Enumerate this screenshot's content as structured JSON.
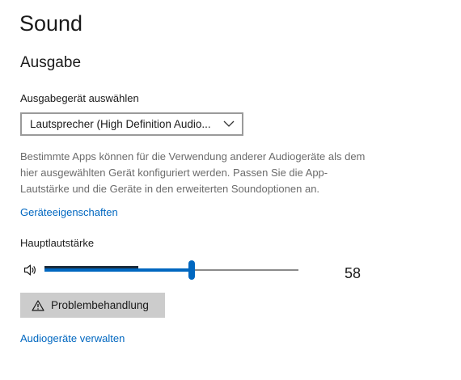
{
  "page": {
    "title": "Sound"
  },
  "output": {
    "heading": "Ausgabe",
    "select_label": "Ausgabegerät auswählen",
    "selected_device": "Lautsprecher (High Definition Audio...",
    "description": "Bestimmte Apps können für die Verwendung anderer Audiogeräte als dem hier ausgewählten Gerät konfiguriert werden. Passen Sie die App-Lautstärke und die Geräte in den erweiterten Soundoptionen an.",
    "device_properties_link": "Geräteeigenschaften",
    "volume_label": "Hauptlautstärke",
    "volume_value": "58",
    "volume_fraction": 0.58,
    "peak_level_fraction": 0.37,
    "troubleshoot_label": "Problembehandlung",
    "manage_devices_link": "Audiogeräte verwalten"
  },
  "icons": {
    "speaker": "speaker-icon",
    "dropdown": "chevron-down-icon",
    "warning": "warning-icon"
  },
  "colors": {
    "accent": "#0067c0",
    "link": "#0067c0",
    "description_text": "#6b6b6b",
    "button_bg": "#cccccc",
    "peak_meter": "#1a2a3a"
  }
}
